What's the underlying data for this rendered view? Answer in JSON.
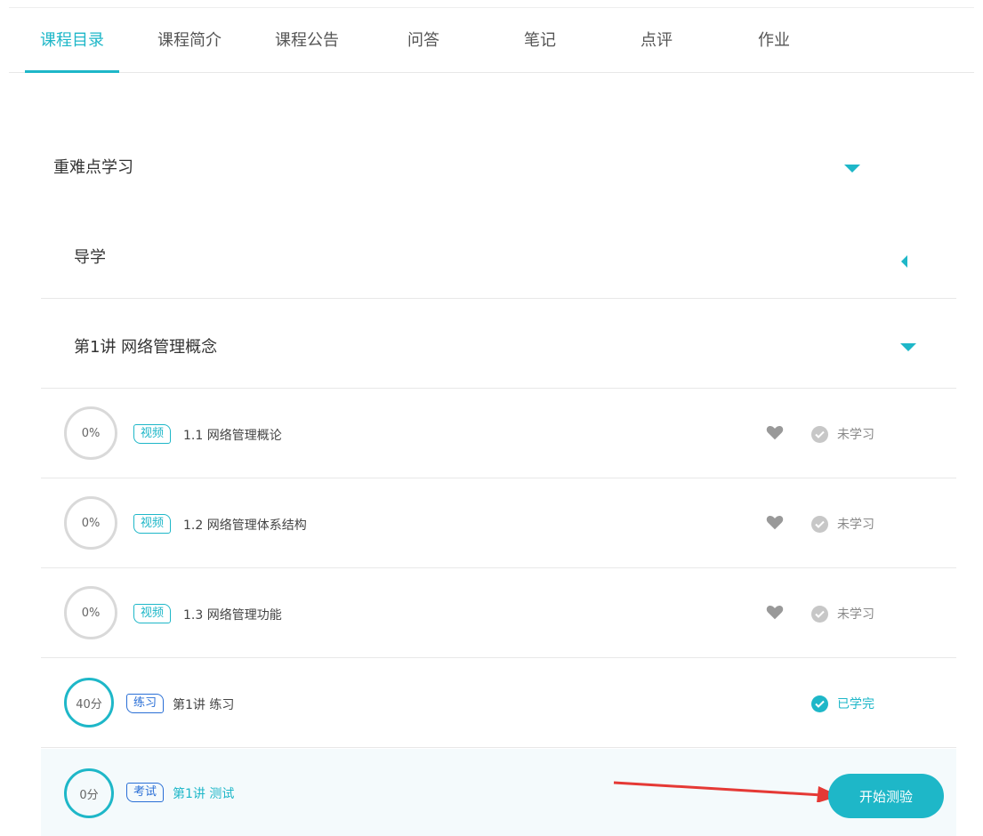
{
  "tabs": [
    "课程目录",
    "课程简介",
    "课程公告",
    "问答",
    "笔记",
    "点评",
    "作业"
  ],
  "section": {
    "title": "重难点学习"
  },
  "chapters": [
    {
      "title": "导学"
    },
    {
      "title": "第1讲 网络管理概念"
    }
  ],
  "items": [
    {
      "progress": "0%",
      "tag": "视频",
      "title": "1.1 网络管理概论",
      "status": "未学习"
    },
    {
      "progress": "0%",
      "tag": "视频",
      "title": "1.2 网络管理体系结构",
      "status": "未学习"
    },
    {
      "progress": "0%",
      "tag": "视频",
      "title": "1.3 网络管理功能",
      "status": "未学习"
    },
    {
      "progress": "40分",
      "tag": "练习",
      "title": "第1讲 练习",
      "status": "已学完"
    },
    {
      "progress": "0分",
      "tag": "考试",
      "title": "第1讲 测试",
      "button": "开始测验"
    }
  ],
  "colors": {
    "accent": "#1eb7c8",
    "tag_blue": "#2a6fd6",
    "arrow": "#e53935"
  },
  "icons": {
    "favorite": "heart-icon",
    "status": "check-circle-icon",
    "expand": "caret-down-icon",
    "collapse": "caret-left-icon"
  }
}
